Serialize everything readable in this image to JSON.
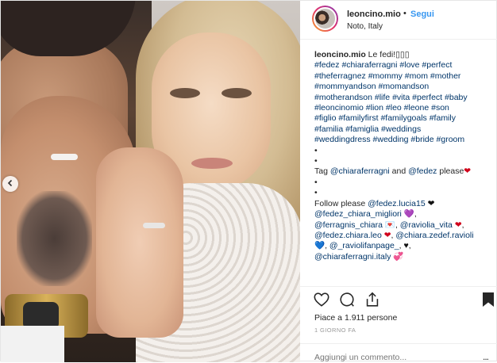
{
  "post": {
    "username": "leoncino.mio",
    "separator": "•",
    "follow_label": "Segui",
    "location": "Noto, Italy"
  },
  "caption": {
    "username": "leoncino.mio",
    "text": " Le fedi!",
    "emoji": "▯▯▯",
    "hashtags_lines": [
      "#fedez #chiaraferragni #love #perfect",
      "#theferragnez #mommy #mom #mother",
      "#mommyandson #momandson",
      "#motherandson #life #vita #perfect #baby",
      "#leoncinomio #lion #leo #leone #son",
      "#figlio #familyfirst #familygoals #family",
      "#familia #famiglia #weddings",
      "#weddingdress #wedding #bride #groom"
    ],
    "bullet": "•",
    "tag_prefix": "Tag ",
    "tag_m1": "@chiaraferragni",
    "tag_and": " and ",
    "tag_m2": "@fedez",
    "tag_suffix": " please",
    "follow_prefix": "Follow please ",
    "follow_lines": [
      {
        "mention": "@fedez.lucia15",
        "heart": "❤",
        "color": "blk"
      },
      {
        "mention": "@fedez_chiara_migliori",
        "heart": "💜",
        "color": "purple",
        "tail": ","
      },
      {
        "mention": "@ferragnis_chiara",
        "heart": "💌",
        "color": "red",
        "tail": ",",
        "mention2": "@raviolia_vita",
        "heart2": "❤",
        "color2": "red"
      },
      {
        "mention": "@fedez.chiara.leo",
        "heart": "❤",
        "color": "red",
        "tail": ",",
        "mention2": "@chiara.zedef.ravioli"
      },
      {
        "lead": "",
        "heart": "💙",
        "color": "cyan",
        "tail": ",",
        "mention2": "@_raviolifanpage_",
        "heart2": "♥",
        "color2": "blk"
      },
      {
        "mention": "@chiaraferragni.italy",
        "heart": "💞",
        "color": "red"
      }
    ]
  },
  "likes": "Piace a 1.911 persone",
  "time": "1 GIORNO FA",
  "add_comment": {
    "placeholder": "Aggiungi un commento...",
    "more": "..."
  },
  "icons": {
    "heart": "heart-icon",
    "comment": "comment-icon",
    "share": "share-icon",
    "save": "bookmark-icon",
    "carousel": "chevron-left-icon"
  },
  "colors": {
    "link": "#003569",
    "follow": "#3897f0",
    "muted": "#999999"
  }
}
